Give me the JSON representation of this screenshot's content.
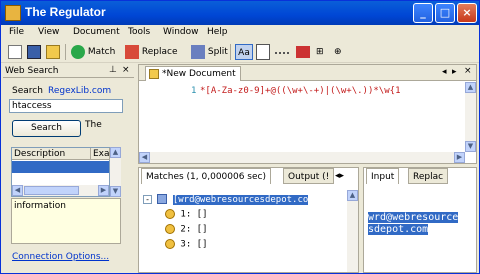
{
  "window": {
    "title": "The Regulator"
  },
  "menu": [
    "File",
    "View",
    "Document",
    "Tools",
    "Window",
    "Help"
  ],
  "toolbar": {
    "match": "Match",
    "replace": "Replace",
    "split": "Split",
    "aa": "Aa"
  },
  "websearch": {
    "title": "Web Search",
    "search_label": "Search",
    "site_link": "RegexLib.com",
    "query": "htaccess",
    "search_button": "Search",
    "side_text": "The",
    "columns": [
      "Description",
      "Exa"
    ],
    "info_text": "information",
    "connection_link": "Connection Options..."
  },
  "editor": {
    "tab": "*New Document",
    "line": "1",
    "pattern": "*[A-Za-z0-9]+@((\\w+\\-+)|(\\w+\\.))*\\w{1"
  },
  "matches": {
    "tab": "Matches (1, 0,000006 sec)",
    "output_tab": "Output (!",
    "root": "[wrd@webresourcesdepot.co",
    "groups": [
      "1: []",
      "2: []",
      "3: []"
    ]
  },
  "inputpane": {
    "tab_input": "Input",
    "tab_replace": "Replac",
    "line1": "wrd@webresource",
    "line2": "sdepot.com"
  },
  "colors": {
    "titlebar": "#0046d5",
    "selection": "#316ac5",
    "code": "#c31b1b"
  }
}
